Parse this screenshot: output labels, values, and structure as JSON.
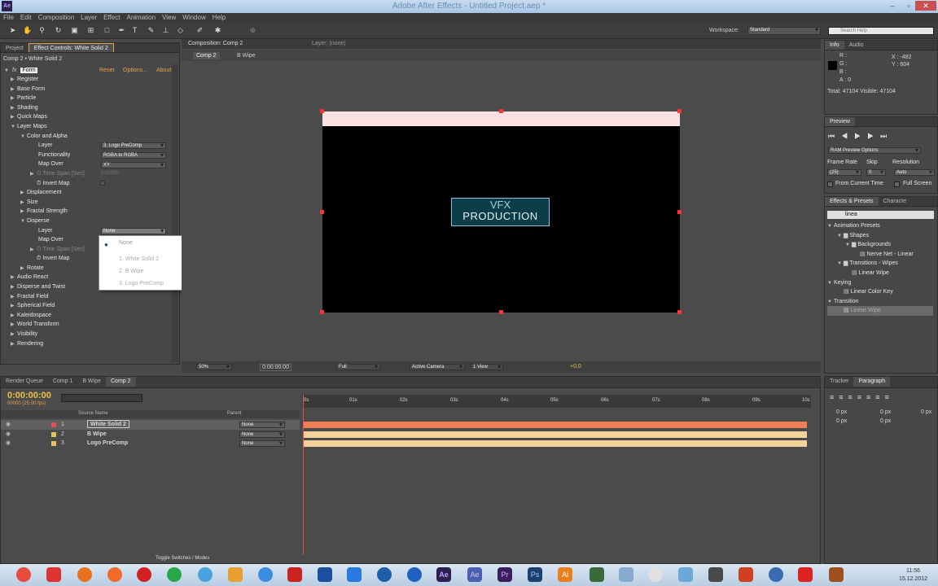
{
  "app": {
    "title": "Adobe After Effects - Untitled Project.aep *",
    "icon_label": "Ae"
  },
  "menu": [
    "File",
    "Edit",
    "Composition",
    "Layer",
    "Effect",
    "Animation",
    "View",
    "Window",
    "Help"
  ],
  "toolbar": {
    "workspace_label": "Workspace:",
    "workspace_value": "Standard",
    "search_placeholder": "Search Help"
  },
  "left_panel": {
    "tabs": [
      "Project",
      "Effect Controls: White Solid 2"
    ],
    "breadcrumb": "Comp 2 • White Solid 2",
    "effect_name": "Form",
    "reset": "Reset",
    "options": "Options...",
    "about": "About",
    "items": [
      "Register",
      "Base Form",
      "Particle",
      "Shading",
      "Quick Maps",
      "Layer Maps",
      "Color and Alpha",
      "Layer",
      "Functionality",
      "Map Over",
      "Time Span [Sec]",
      "Invert Map",
      "Displacement",
      "Size",
      "Fractal Strength",
      "Disperse",
      "Layer",
      "Map Over",
      "Time Span [Sec]",
      "Invert Map",
      "Rotate",
      "Audio React",
      "Disperse and Twist",
      "Fractal Field",
      "Spherical Field",
      "Kaleidospace",
      "World Transform",
      "Visibility",
      "Rendering"
    ],
    "color_alpha_layer": "3. Logo PreComp",
    "functionality": "RGBA to RGBA",
    "map_over": "XY",
    "time_span": "5,00000",
    "disperse_layer": "None",
    "popup": [
      "None",
      "1. White Solid 2",
      "2. B Wipe",
      "3. Logo PreComp"
    ]
  },
  "viewer": {
    "tabs": [
      "Composition: Comp 2",
      "Layer: (none)"
    ],
    "subtabs": [
      "Comp 2",
      "B Wipe"
    ],
    "logo_line1": "VFX",
    "logo_line2": "PRODUCTION",
    "zoom": "50%",
    "timecode": "0:00:00:00",
    "resolution": "Full",
    "camera": "Active Camera",
    "views": "1 View",
    "exposure": "+0,0"
  },
  "info": {
    "tabs": [
      "Info",
      "Audio"
    ],
    "r": "R :",
    "g": "G :",
    "b": "B :",
    "a": "A : 0",
    "x": "X : -482",
    "y": "Y : 604",
    "total": "Total: 47104  Visible: 47104"
  },
  "preview": {
    "tab": "Preview",
    "ram": "RAM Preview Options",
    "frame_rate_label": "Frame Rate",
    "skip_label": "Skip",
    "resolution_label": "Resolution",
    "frame_rate": "(25)",
    "skip": "0",
    "resolution": "Auto",
    "from_current": "From Current Time",
    "full_screen": "Full Screen"
  },
  "effects": {
    "tabs": [
      "Effects & Presets",
      "Characte"
    ],
    "search": "linea",
    "items": [
      "Animation Presets",
      "Shapes",
      "Backgrounds",
      "Nerve Net - Linear",
      "Transitions - Wipes",
      "Linear Wipe",
      "Keying",
      "Linear Color Key",
      "Transition",
      "Linear Wipe"
    ]
  },
  "timeline": {
    "tabs": [
      "Render Queue",
      "Comp 1",
      "B Wipe",
      "Comp 2"
    ],
    "timecode": "0:00:00:00",
    "fps": "00000 (25.00 fps)",
    "source_header": "Source Name",
    "parent_header": "Parent",
    "layers": [
      {
        "num": "1",
        "name": "White Solid 2",
        "parent": "None"
      },
      {
        "num": "2",
        "name": "B Wipe",
        "parent": "None"
      },
      {
        "num": "3",
        "name": "Logo PreComp",
        "parent": "None"
      }
    ],
    "ruler": [
      "0s",
      "01s",
      "02s",
      "03s",
      "04s",
      "05s",
      "06s",
      "07s",
      "08s",
      "09s",
      "10s"
    ],
    "toggle": "Toggle Switches / Modes"
  },
  "right_bottom": {
    "tabs": [
      "Tracker",
      "Paragraph"
    ],
    "px_values": [
      "0 px",
      "0 px",
      "0 px",
      "0 px",
      "0 px"
    ]
  },
  "taskbar": {
    "time": "11:56",
    "date": "15.12.2012"
  }
}
